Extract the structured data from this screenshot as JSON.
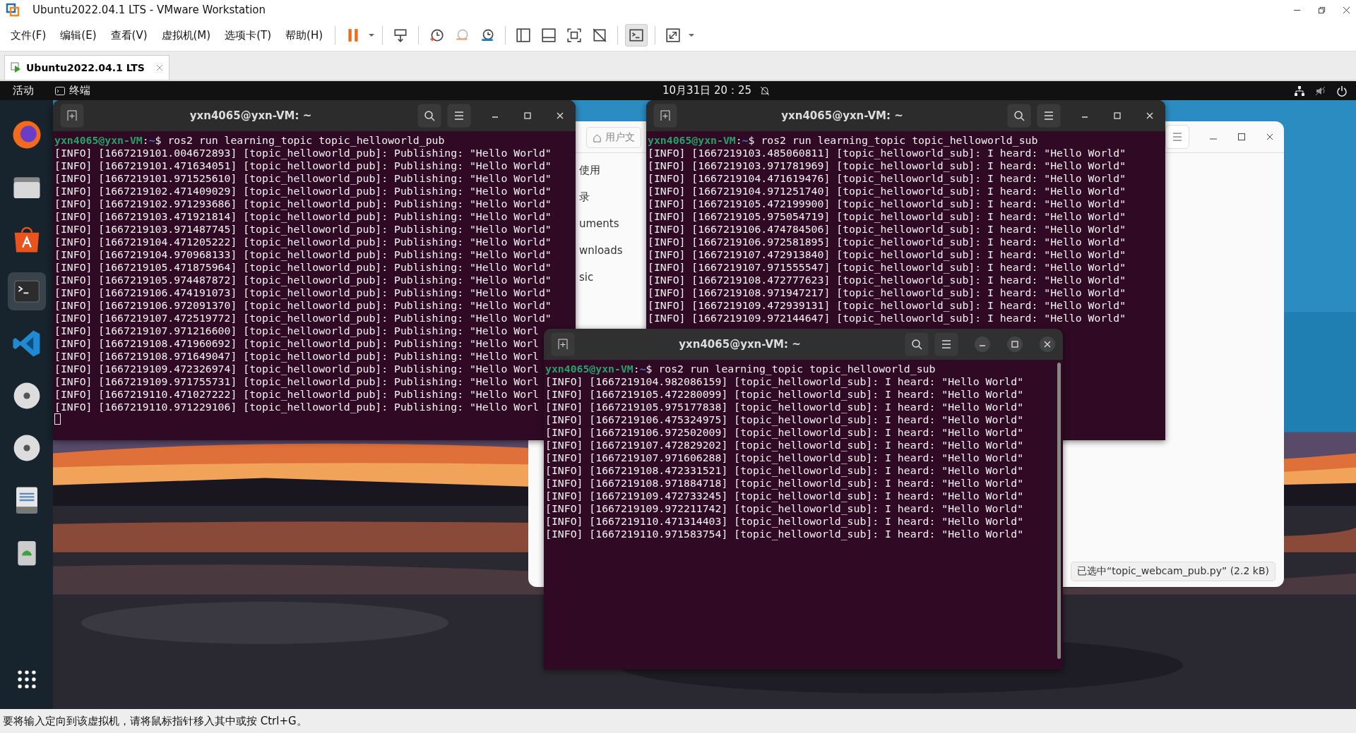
{
  "window": {
    "title": "Ubuntu2022.04.1 LTS - VMware Workstation"
  },
  "menu": [
    "文件(F)",
    "编辑(E)",
    "查看(V)",
    "虚拟机(M)",
    "选项卡(T)",
    "帮助(H)"
  ],
  "vm_tabs": [
    {
      "label": "Ubuntu2022.04.1 LTS",
      "selected": true
    }
  ],
  "topbar": {
    "activities": "活动",
    "app": "终端",
    "clock": "10月31日  20：25"
  },
  "file_manager": {
    "path_button": "用户文",
    "sidebar": [
      "使用",
      "录",
      "uments",
      "wnloads",
      "sic"
    ],
    "status": "已选中“topic_webcam_pub.py” (2.2 kB)"
  },
  "terminals": [
    {
      "title": "yxn4065@yxn-VM: ~",
      "focused": false,
      "cursor": true,
      "prompt_user": "yxn4065@yxn-VM",
      "prompt_sep": ":",
      "prompt_path": "~",
      "prompt_sign": "$",
      "command": "ros2 run learning_topic topic_helloworld_pub",
      "lines": [
        "[INFO] [1667219101.004672893] [topic_helloworld_pub]: Publishing: \"Hello World\"",
        "[INFO] [1667219101.471634051] [topic_helloworld_pub]: Publishing: \"Hello World\"",
        "[INFO] [1667219101.971525610] [topic_helloworld_pub]: Publishing: \"Hello World\"",
        "[INFO] [1667219102.471409029] [topic_helloworld_pub]: Publishing: \"Hello World\"",
        "[INFO] [1667219102.971293686] [topic_helloworld_pub]: Publishing: \"Hello World\"",
        "[INFO] [1667219103.471921814] [topic_helloworld_pub]: Publishing: \"Hello World\"",
        "[INFO] [1667219103.971487745] [topic_helloworld_pub]: Publishing: \"Hello World\"",
        "[INFO] [1667219104.471205222] [topic_helloworld_pub]: Publishing: \"Hello World\"",
        "[INFO] [1667219104.970968133] [topic_helloworld_pub]: Publishing: \"Hello World\"",
        "[INFO] [1667219105.471875964] [topic_helloworld_pub]: Publishing: \"Hello World\"",
        "[INFO] [1667219105.974487872] [topic_helloworld_pub]: Publishing: \"Hello World\"",
        "[INFO] [1667219106.474191073] [topic_helloworld_pub]: Publishing: \"Hello World\"",
        "[INFO] [1667219106.972091370] [topic_helloworld_pub]: Publishing: \"Hello World\"",
        "[INFO] [1667219107.472519772] [topic_helloworld_pub]: Publishing: \"Hello World\"",
        "[INFO] [1667219107.971216600] [topic_helloworld_pub]: Publishing: \"Hello Worl",
        "[INFO] [1667219108.471960692] [topic_helloworld_pub]: Publishing: \"Hello Worl",
        "[INFO] [1667219108.971649047] [topic_helloworld_pub]: Publishing: \"Hello Worl",
        "[INFO] [1667219109.472326974] [topic_helloworld_pub]: Publishing: \"Hello Worl",
        "[INFO] [1667219109.971755731] [topic_helloworld_pub]: Publishing: \"Hello Worl",
        "[INFO] [1667219110.471027222] [topic_helloworld_pub]: Publishing: \"Hello Worl",
        "[INFO] [1667219110.971229106] [topic_helloworld_pub]: Publishing: \"Hello Worl"
      ]
    },
    {
      "title": "yxn4065@yxn-VM: ~",
      "focused": false,
      "cursor": false,
      "prompt_user": "yxn4065@yxn-VM",
      "prompt_sep": ":",
      "prompt_path": "~",
      "prompt_sign": "$",
      "command": "ros2 run learning_topic topic_helloworld_sub",
      "lines": [
        "[INFO] [1667219103.485060811] [topic_helloworld_sub]: I heard: \"Hello World\"",
        "[INFO] [1667219103.971781969] [topic_helloworld_sub]: I heard: \"Hello World\"",
        "[INFO] [1667219104.471619476] [topic_helloworld_sub]: I heard: \"Hello World\"",
        "[INFO] [1667219104.971251740] [topic_helloworld_sub]: I heard: \"Hello World\"",
        "[INFO] [1667219105.472199900] [topic_helloworld_sub]: I heard: \"Hello World\"",
        "[INFO] [1667219105.975054719] [topic_helloworld_sub]: I heard: \"Hello World\"",
        "[INFO] [1667219106.474784506] [topic_helloworld_sub]: I heard: \"Hello World\"",
        "[INFO] [1667219106.972581895] [topic_helloworld_sub]: I heard: \"Hello World\"",
        "[INFO] [1667219107.472913840] [topic_helloworld_sub]: I heard: \"Hello World\"",
        "[INFO] [1667219107.971555547] [topic_helloworld_sub]: I heard: \"Hello World\"",
        "[INFO] [1667219108.472777623] [topic_helloworld_sub]: I heard: \"Hello World\"",
        "[INFO] [1667219108.971947217] [topic_helloworld_sub]: I heard: \"Hello World\"",
        "[INFO] [1667219109.472939131] [topic_helloworld_sub]: I heard: \"Hello World\"",
        "[INFO] [1667219109.972144647] [topic_helloworld_sub]: I heard: \"Hello World\""
      ]
    },
    {
      "title": "yxn4065@yxn-VM: ~",
      "focused": true,
      "cursor": false,
      "prompt_user": "yxn4065@yxn-VM",
      "prompt_sep": ":",
      "prompt_path": "~",
      "prompt_sign": "$",
      "command": "ros2 run learning_topic topic_helloworld_sub",
      "lines": [
        "[INFO] [1667219104.982086159] [topic_helloworld_sub]: I heard: \"Hello World\"",
        "[INFO] [1667219105.472280099] [topic_helloworld_sub]: I heard: \"Hello World\"",
        "[INFO] [1667219105.975177838] [topic_helloworld_sub]: I heard: \"Hello World\"",
        "[INFO] [1667219106.475324975] [topic_helloworld_sub]: I heard: \"Hello World\"",
        "[INFO] [1667219106.972502009] [topic_helloworld_sub]: I heard: \"Hello World\"",
        "[INFO] [1667219107.472829202] [topic_helloworld_sub]: I heard: \"Hello World\"",
        "[INFO] [1667219107.971606288] [topic_helloworld_sub]: I heard: \"Hello World\"",
        "[INFO] [1667219108.472331521] [topic_helloworld_sub]: I heard: \"Hello World\"",
        "[INFO] [1667219108.971884718] [topic_helloworld_sub]: I heard: \"Hello World\"",
        "[INFO] [1667219109.472733245] [topic_helloworld_sub]: I heard: \"Hello World\"",
        "[INFO] [1667219109.972211742] [topic_helloworld_sub]: I heard: \"Hello World\"",
        "[INFO] [1667219110.471314403] [topic_helloworld_sub]: I heard: \"Hello World\"",
        "[INFO] [1667219110.971583754] [topic_helloworld_sub]: I heard: \"Hello World\""
      ]
    }
  ],
  "status_bar": {
    "text": "要将输入定向到该虚拟机，请将鼠标指针移入其中或按 Ctrl+G。"
  }
}
